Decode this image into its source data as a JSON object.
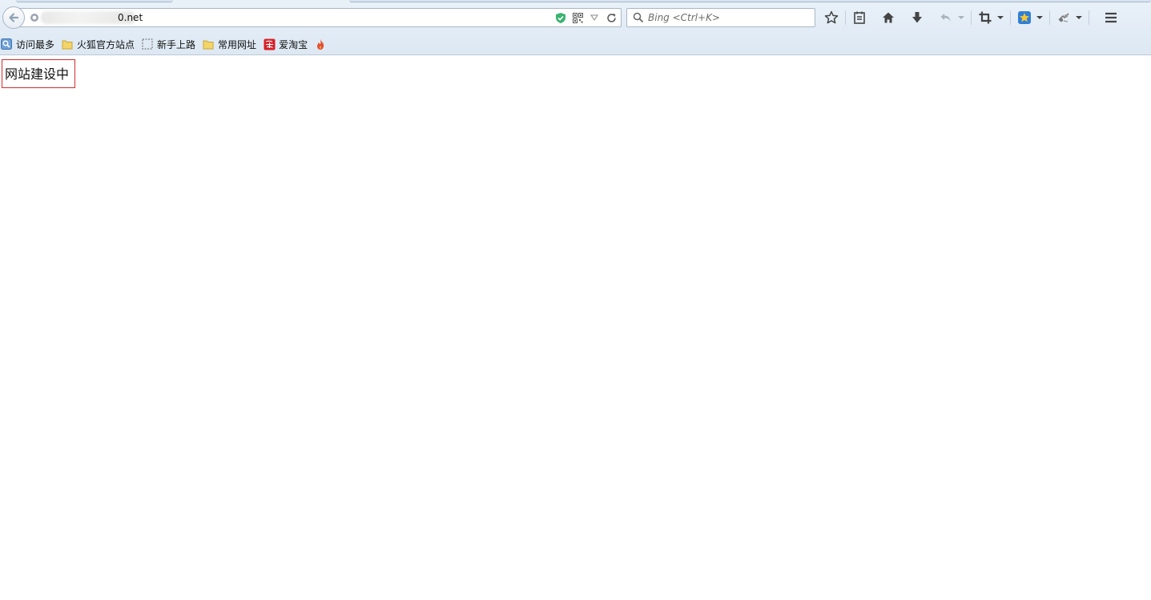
{
  "browser": {
    "address_bar": {
      "url_suffix": "0.net"
    },
    "search_bar": {
      "placeholder": "Bing  <Ctrl+K>"
    },
    "toolbar_icons": [
      "bookmark-star-icon",
      "reading-list-icon",
      "home-icon",
      "download-icon",
      "undo-icon",
      "crop-icon",
      "favorites-icon",
      "extension-icon",
      "menu-icon"
    ]
  },
  "bookmarks": [
    {
      "label": "访问最多",
      "icon": "most-visited-icon"
    },
    {
      "label": "火狐官方站点",
      "icon": "folder-icon"
    },
    {
      "label": "新手上路",
      "icon": "dashed-page-icon"
    },
    {
      "label": "常用网址",
      "icon": "folder-icon"
    },
    {
      "label": "爱淘宝",
      "icon": "taobao-icon"
    },
    {
      "label": "",
      "icon": "flame-icon"
    }
  ],
  "page": {
    "notice_text": "网站建设中"
  },
  "colors": {
    "notice_border": "#d22d2d",
    "chrome_bg": "#dde8f3",
    "security_shield": "#3cb371",
    "taobao_red": "#d61f26"
  }
}
